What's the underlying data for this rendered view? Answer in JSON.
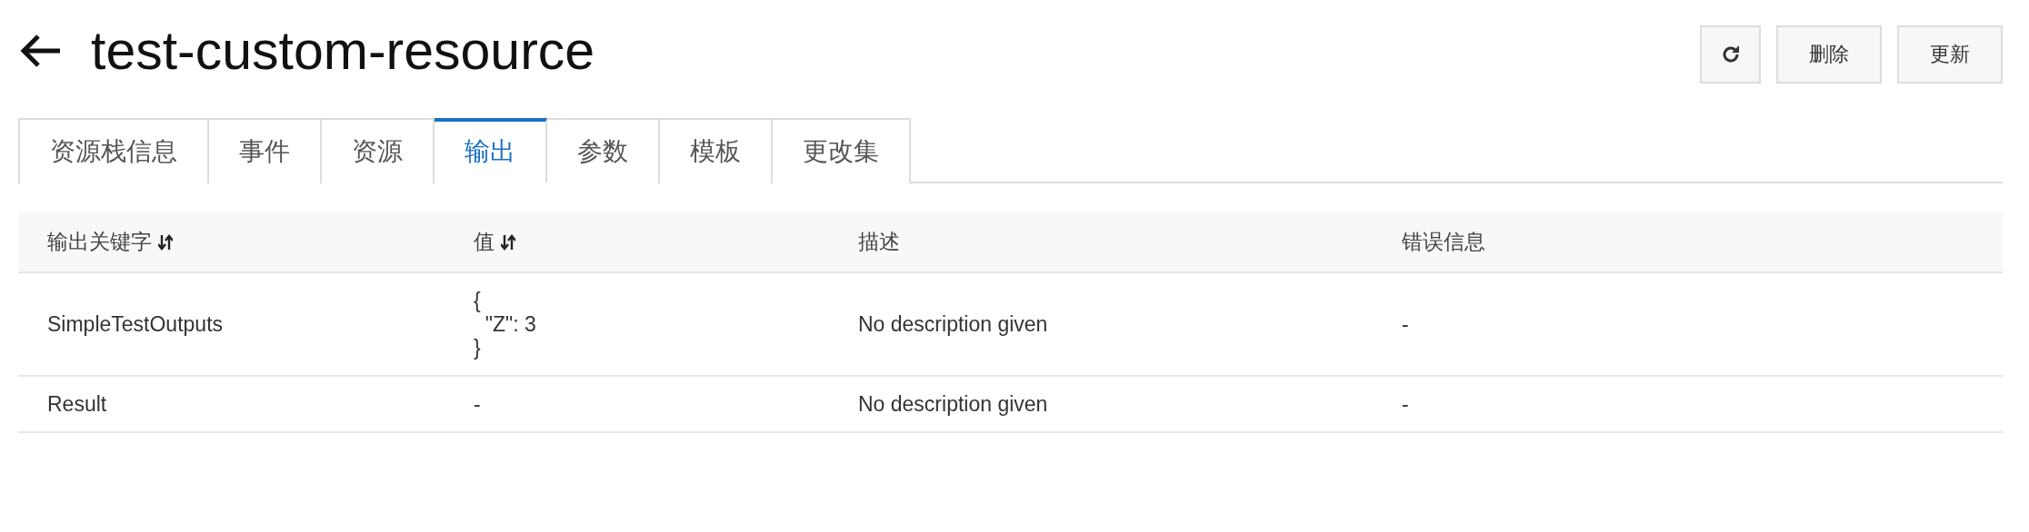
{
  "header": {
    "title": "test-custom-resource"
  },
  "actions": [
    {
      "kind": "icon"
    },
    {
      "kind": "text",
      "label": "删除"
    },
    {
      "kind": "text",
      "label": "更新"
    }
  ],
  "tabs": [
    {
      "label": "资源栈信息",
      "selected": false
    },
    {
      "label": "事件",
      "selected": false
    },
    {
      "label": "资源",
      "selected": false
    },
    {
      "label": "输出",
      "selected": true
    },
    {
      "label": "参数",
      "selected": false
    },
    {
      "label": "模板",
      "selected": false
    },
    {
      "label": "更改集",
      "selected": false
    }
  ],
  "table": {
    "columns": [
      {
        "label": "输出关键字",
        "sortable": true
      },
      {
        "label": "值",
        "sortable": true
      },
      {
        "label": "描述",
        "sortable": false
      },
      {
        "label": "错误信息",
        "sortable": false
      }
    ],
    "rows": [
      [
        "SimpleTestOutputs",
        "{\n  \"Z\": 3\n}",
        "No description given",
        "-"
      ],
      [
        "Result",
        "-",
        "No description given",
        "-"
      ]
    ]
  }
}
